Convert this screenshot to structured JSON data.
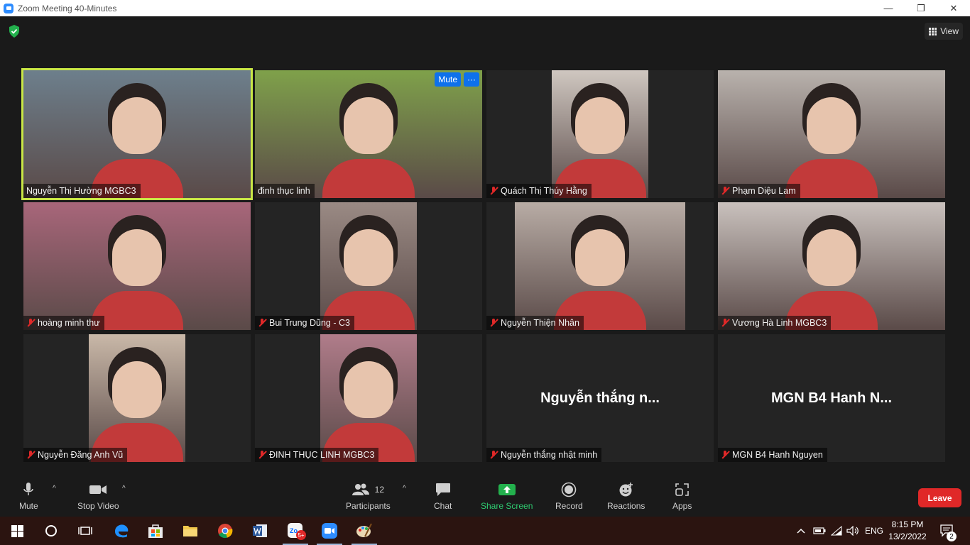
{
  "window": {
    "title": "Zoom Meeting 40-Minutes",
    "controls": [
      "—",
      "❐",
      "✕"
    ]
  },
  "header": {
    "view_label": "View"
  },
  "participants": [
    {
      "name": "Nguyễn Thị Hường MGBC3",
      "muted": false,
      "active": true,
      "video": "full",
      "bg": "#6d7f8c"
    },
    {
      "name": "đinh thục linh",
      "muted": false,
      "active": false,
      "video": "full",
      "bg": "#7fa14a",
      "hover_mute": "Mute",
      "hover_more": "···"
    },
    {
      "name": "Quách Thị Thúy Hằng",
      "muted": true,
      "active": false,
      "video": "center",
      "bg": "#cfc7c0"
    },
    {
      "name": "Phạm Diệu Lam",
      "muted": true,
      "active": false,
      "video": "full",
      "bg": "#b9b2ad"
    },
    {
      "name": "hoàng minh thư",
      "muted": true,
      "active": false,
      "video": "full",
      "bg": "#a8667a"
    },
    {
      "name": "Bui Trung Dũng - C3",
      "muted": true,
      "active": false,
      "video": "center",
      "bg": "#9a8a84"
    },
    {
      "name": "Nguyễn Thiện Nhân",
      "muted": true,
      "active": false,
      "video": "wide",
      "bg": "#b8aca5"
    },
    {
      "name": "Vương Hà Linh MGBC3",
      "muted": true,
      "active": false,
      "video": "full",
      "bg": "#c9c1bd"
    },
    {
      "name": "Nguyễn Đăng Anh Vũ",
      "muted": true,
      "active": false,
      "video": "center",
      "bg": "#c9b8a8"
    },
    {
      "name": "ĐINH THỤC LINH MGBC3",
      "muted": true,
      "active": false,
      "video": "center",
      "bg": "#b07c8a"
    },
    {
      "name": "Nguyễn thắng nhật minh",
      "muted": true,
      "active": false,
      "video": "none",
      "display_name": "Nguyễn thắng n..."
    },
    {
      "name": "MGN B4 Hanh Nguyen",
      "muted": true,
      "active": false,
      "video": "none",
      "display_name": "MGN B4 Hanh N..."
    }
  ],
  "toolbar": {
    "mute_label": "Mute",
    "stop_video_label": "Stop Video",
    "participants_label": "Participants",
    "participants_count": "12",
    "chat_label": "Chat",
    "share_label": "Share Screen",
    "record_label": "Record",
    "reactions_label": "Reactions",
    "apps_label": "Apps",
    "leave_label": "Leave"
  },
  "taskbar": {
    "zalo_badge": "5+",
    "language": "ENG",
    "time": "8:15 PM",
    "date": "13/2/2022",
    "notification_count": "2"
  },
  "colors": {
    "active_speaker": "#c8e645",
    "leave": "#e02828",
    "share": "#2ecc71",
    "mute_hover": "#0e71eb"
  }
}
